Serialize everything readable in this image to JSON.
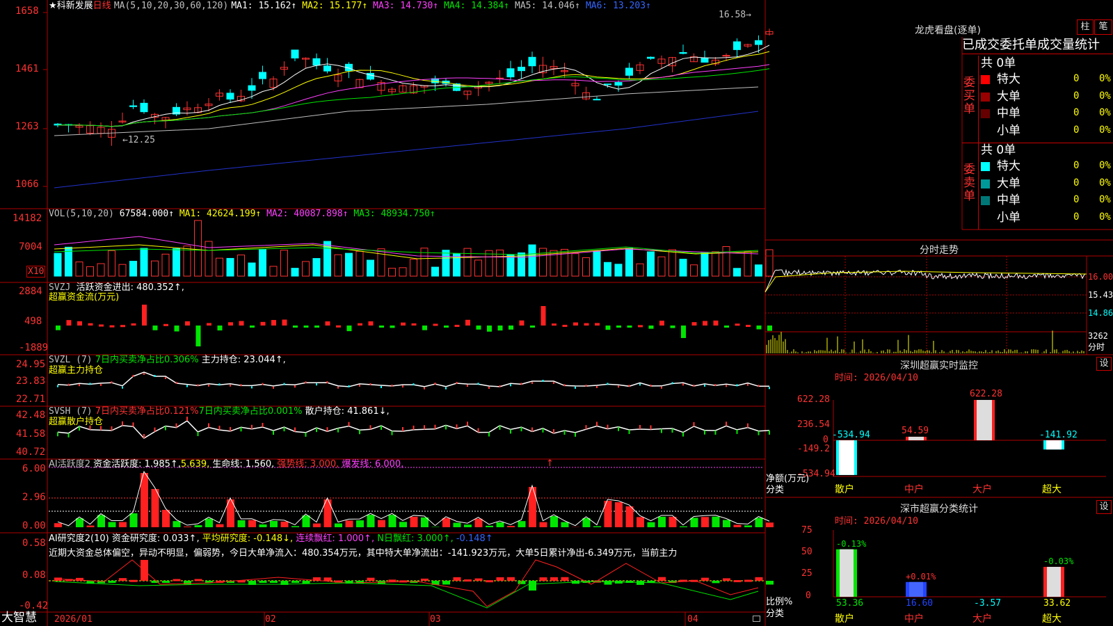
{
  "stock": {
    "name": "★科新发展",
    "period": "日线",
    "ma_params": "MA(5,10,20,30,60,120)",
    "ma": [
      {
        "label": "MA1: 15.162↑",
        "color": "#ffffff"
      },
      {
        "label": "MA2: 15.177↑",
        "color": "#ffff00"
      },
      {
        "label": "MA3: 14.730↑",
        "color": "#ff40ff"
      },
      {
        "label": "MA4: 14.384↑",
        "color": "#00e600"
      },
      {
        "label": "MA5: 14.046↑",
        "color": "#c0c0c0"
      },
      {
        "label": "MA6: 13.203↑",
        "color": "#3366ff"
      }
    ],
    "price_ticks": [
      "1658",
      "1461",
      "1263",
      "1066"
    ],
    "high_mark": "16.58",
    "low_mark": "12.25"
  },
  "volume": {
    "params": "VOL(5,10,20)",
    "value": "67584.000↑",
    "ma1": "MA1: 42624.199↑",
    "ma2": "MA2: 40087.898↑",
    "ma3": "MA3: 48934.750↑",
    "ticks": [
      "14182",
      "7004"
    ],
    "unit": "X10"
  },
  "svzj": {
    "name": "SVZJ",
    "label": "活跃资金进出: 480.352↑,",
    "sub": "超赢资金流(万元)",
    "ticks": [
      "2884",
      "498",
      "-1889"
    ]
  },
  "svzl": {
    "name": "SVZL (7)",
    "label1": "7日内买卖净占比0.306%",
    "label2": "主力持仓: 23.044↑,",
    "sub": "超赢主力持仓",
    "ticks": [
      "24.95",
      "23.83",
      "22.71"
    ]
  },
  "svsh": {
    "name": "SVSH (7)",
    "label1": "7日内买卖净占比0.121%",
    "label2": "7日内买卖净占比0.001%",
    "label3": "散户持仓: 41.861↓,",
    "sub": "超赢散户持仓",
    "ticks": [
      "42.48",
      "41.58",
      "40.72"
    ]
  },
  "ai_active": {
    "name": "AI活跃度2",
    "label1": "资金活跃度: 1.985↑,",
    "label2": "5.639,",
    "label3": "生命线: 1.560,",
    "label4": "强势线: 3.000,",
    "label5": "爆发线: 6.000,",
    "arrow": "↑",
    "ticks": [
      "6.00",
      "2.96",
      "0.00"
    ]
  },
  "ai_research": {
    "name": "AI研究度2(10)",
    "label1": "资金研究度: 0.033↑,",
    "label2": "平均研究度: -0.148↓,",
    "label3": "连续飘红: 1.000↑,",
    "label4": "N日飘红: 3.000↑,",
    "label5": "-0.148↑",
    "commentary": "近期大资金总体偏空，异动不明显，偏弱势，今日大单净流入：480.354万元，其中特大单净流出：-141.923万元，大单5日累计净出-6.349万元，当前主力",
    "ticks": [
      "0.58",
      "0.08",
      "-0.42"
    ]
  },
  "xaxis": {
    "logo": "大智慧",
    "labels": [
      "2026/01",
      "02",
      "03",
      "04"
    ]
  },
  "right": {
    "dragon_title": "龙虎看盘(逐单)",
    "btn_bar": "柱",
    "btn_pen": "笔",
    "tabs": [
      "已成交",
      "委托单",
      "成交量统计"
    ],
    "buy": {
      "side_label": "委买单",
      "total": "共 0单",
      "rows": [
        {
          "name": "特大",
          "count": "0",
          "pct": "0%",
          "color": "#ff0000"
        },
        {
          "name": "大单",
          "count": "0",
          "pct": "0%",
          "color": "#990000"
        },
        {
          "name": "中单",
          "count": "0",
          "pct": "0%",
          "color": "#660000"
        },
        {
          "name": "小单",
          "count": "0",
          "pct": "0%",
          "color": ""
        }
      ]
    },
    "sell": {
      "side_label": "委卖单",
      "total": "共 0单",
      "rows": [
        {
          "name": "特大",
          "count": "0",
          "pct": "0%",
          "color": "#00ffff"
        },
        {
          "name": "大单",
          "count": "0",
          "pct": "0%",
          "color": "#009999"
        },
        {
          "name": "中单",
          "count": "0",
          "pct": "0%",
          "color": "#007777"
        },
        {
          "name": "小单",
          "count": "0",
          "pct": "0%",
          "color": ""
        }
      ]
    },
    "intraday": {
      "title": "分时走势",
      "ticks": [
        "16.00",
        "15.43",
        "14.86"
      ],
      "vol_tick": "3262",
      "vol_label": "分时"
    },
    "sz_monitor": {
      "title": "深圳超赢实时监控",
      "btn": "设",
      "time": "时间: 2026/04/10",
      "ticks": [
        "622.28",
        "236.54",
        "0",
        "-149.2",
        "-534.94"
      ],
      "y_label": "净额(万元)",
      "x_label": "分类",
      "categories": [
        "散户",
        "中户",
        "大户",
        "超大"
      ],
      "values": [
        -534.94,
        54.59,
        622.28,
        -141.92
      ],
      "value_labels": [
        "-534.94",
        "54.59",
        "622.28",
        "-141.92"
      ]
    },
    "sz_classify": {
      "title": "深市超赢分类统计",
      "btn": "设",
      "time": "时间: 2026/04/10",
      "ticks": [
        "75",
        "50",
        "25",
        "0"
      ],
      "y_label": "比例%",
      "x_label": "分类",
      "categories": [
        "散户",
        "中户",
        "大户",
        "超大"
      ],
      "bar_values": [
        53.36,
        16.6,
        0,
        33.62
      ],
      "bottom_labels": [
        "53.36",
        "16.60",
        "-3.57",
        "33.62"
      ],
      "top_labels": [
        "-0.13%",
        "+0.01%",
        "",
        "-0.03%"
      ]
    }
  },
  "chart_data": [
    {
      "type": "bar",
      "title": "深圳超赢实时监控",
      "ylabel": "净额(万元)",
      "categories": [
        "散户",
        "中户",
        "大户",
        "超大"
      ],
      "values": [
        -534.94,
        54.59,
        622.28,
        -141.92
      ],
      "ylim": [
        -534.94,
        622.28
      ]
    },
    {
      "type": "bar",
      "title": "深市超赢分类统计",
      "ylabel": "比例%",
      "categories": [
        "散户",
        "中户",
        "大户",
        "超大"
      ],
      "values": [
        53.36,
        16.6,
        -3.57,
        33.62
      ],
      "ylim": [
        0,
        75
      ]
    }
  ]
}
